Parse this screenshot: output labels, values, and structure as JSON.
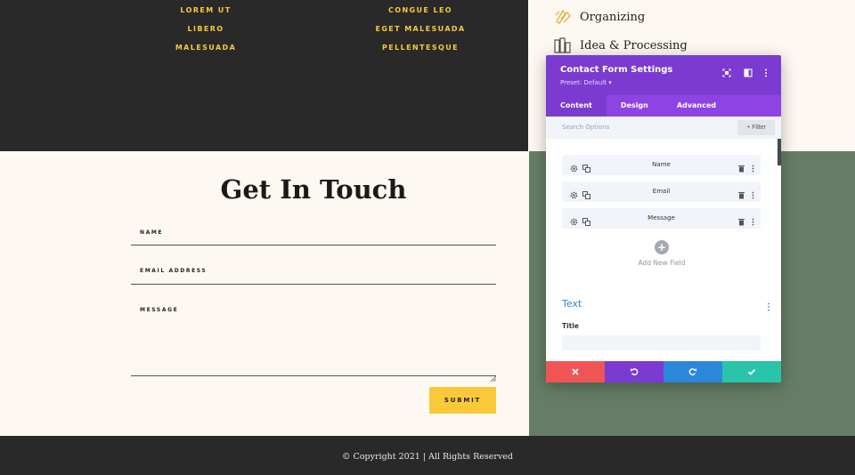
{
  "top_links": {
    "col1": [
      "Lorem Ut",
      "Libero",
      "Malesuada"
    ],
    "col2": [
      "Congue Leo",
      "Eget Malesuada",
      "Pellentesque"
    ]
  },
  "features": [
    {
      "label": "Organizing",
      "icon": "organizing-icon"
    },
    {
      "label": "Idea & Processing",
      "icon": "idea-processing-icon"
    }
  ],
  "contact": {
    "title": "Get In Touch",
    "fields": {
      "name_label": "Name",
      "email_label": "Email Address",
      "message_label": "Message"
    },
    "submit_label": "Submit"
  },
  "footer": {
    "text": "© Copyright 2021 | All Rights Reserved"
  },
  "panel": {
    "title": "Contact Form Settings",
    "preset": "Preset: Default ▾",
    "tabs": [
      {
        "label": "Content",
        "active": true
      },
      {
        "label": "Design",
        "active": false
      },
      {
        "label": "Advanced",
        "active": false
      }
    ],
    "search_placeholder": "Search Options",
    "filter_label": "+ Filter",
    "fields": [
      "Name",
      "Email",
      "Message"
    ],
    "add_new_label": "Add New Field",
    "add_symbol": "+",
    "section_title": "Text",
    "title_label": "Title"
  },
  "colors": {
    "dark": "#292929",
    "accent_yellow": "#f9c93a",
    "cream": "#fdf8f1",
    "green": "#667d65",
    "panel_purple": "#7b3bd1",
    "tab_purple": "#8e44e3",
    "cancel": "#ef5555",
    "undo": "#7b3bd1",
    "redo": "#2b87da",
    "save": "#29c4a9"
  }
}
